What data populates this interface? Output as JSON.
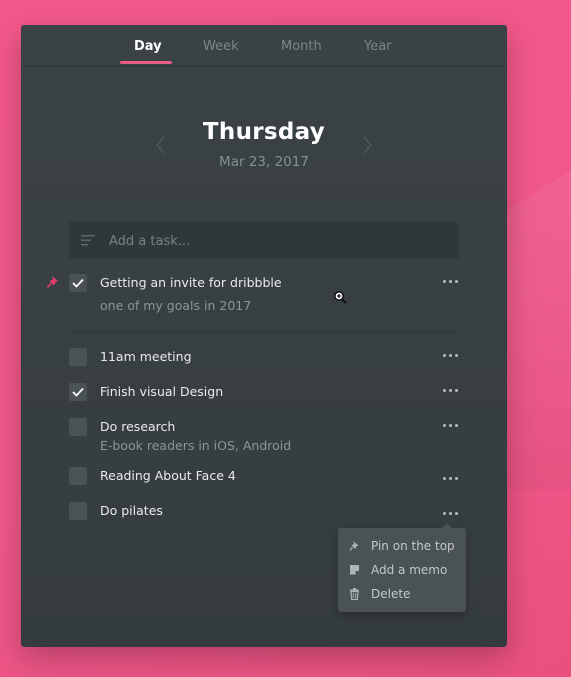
{
  "tabs": [
    {
      "label": "Day",
      "active": true
    },
    {
      "label": "Week",
      "active": false
    },
    {
      "label": "Month",
      "active": false
    },
    {
      "label": "Year",
      "active": false
    }
  ],
  "date_header": {
    "weekday": "Thursday",
    "date": "Mar 23, 2017"
  },
  "add_task": {
    "placeholder": "Add a task...",
    "icon": "lines-icon"
  },
  "tasks": [
    {
      "label": "Getting an invite for dribbble",
      "subtitle": "one of my goals in 2017",
      "checked": true,
      "pinned": true
    },
    {
      "label": "11am meeting",
      "subtitle": "",
      "checked": false,
      "pinned": false
    },
    {
      "label": "Finish visual Design",
      "subtitle": "",
      "checked": true,
      "pinned": false
    },
    {
      "label": "Do research",
      "subtitle": "E-book readers in iOS, Android",
      "checked": false,
      "pinned": false
    },
    {
      "label": "Reading About Face 4",
      "subtitle": "",
      "checked": false,
      "pinned": false
    },
    {
      "label": "Do pilates",
      "subtitle": "",
      "checked": false,
      "pinned": false
    }
  ],
  "context_menu": {
    "items": [
      {
        "label": "Pin on the top",
        "icon": "pin-icon"
      },
      {
        "label": "Add a memo",
        "icon": "memo-icon"
      },
      {
        "label": "Delete",
        "icon": "trash-icon"
      }
    ]
  },
  "colors": {
    "accent": "#ea5a86",
    "panel": "#3b4246",
    "background": "#f3588a",
    "pin": "#ea3f6e"
  }
}
